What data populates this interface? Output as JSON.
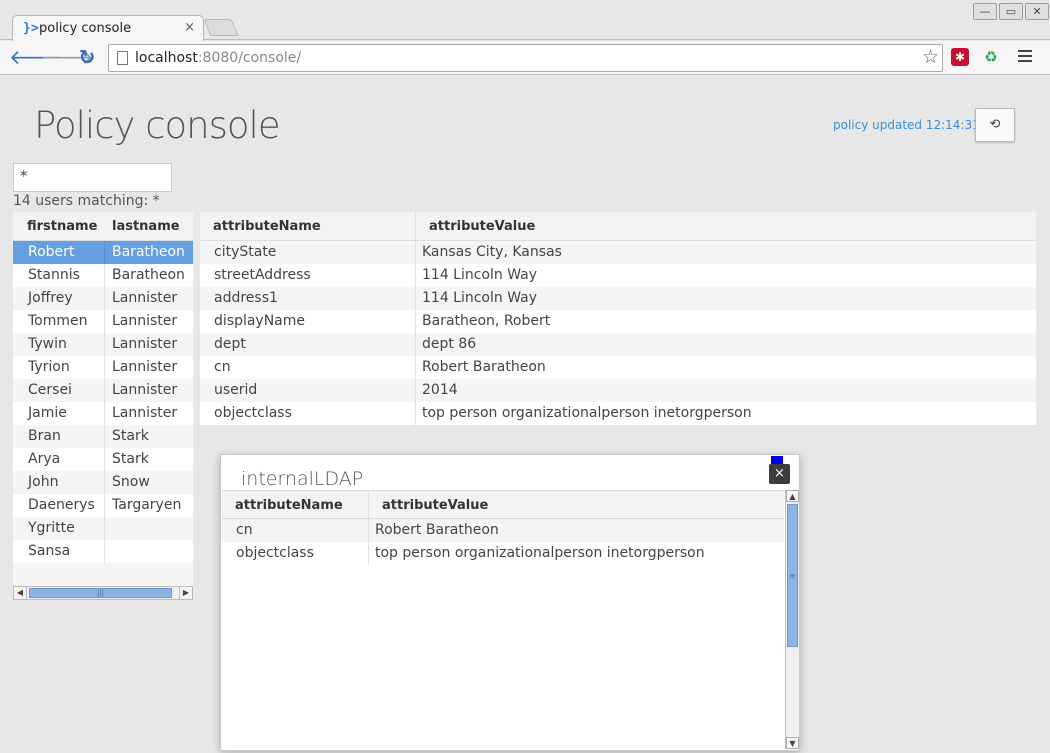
{
  "browser": {
    "tab_title": "policy console",
    "tab_icon": "}>",
    "tab_close": "×",
    "url_host": "localhost",
    "url_path": ":8080/console/",
    "window_buttons": [
      "—",
      "▭",
      "✕"
    ],
    "nav": {
      "back": "🡐",
      "forward": "🡒",
      "reload": "↻"
    },
    "star": "☆",
    "extensions": [
      {
        "name": "lastpass-icon",
        "glyph": "✱",
        "color": "#c8102e"
      },
      {
        "name": "evernote-icon",
        "glyph": "♻",
        "color": "#2ea44f"
      }
    ]
  },
  "page": {
    "title": "Policy console",
    "policy_status": "policy updated 12:14:31",
    "refresh_icon": "⟲"
  },
  "search": {
    "value": "*"
  },
  "match_count": "14 users matching: *",
  "users": {
    "headers": [
      "firstname",
      "lastname"
    ],
    "selected_index": 0,
    "rows": [
      [
        "Robert",
        "Baratheon"
      ],
      [
        "Stannis",
        "Baratheon"
      ],
      [
        "Joffrey",
        "Lannister"
      ],
      [
        "Tommen",
        "Lannister"
      ],
      [
        "Tywin",
        "Lannister"
      ],
      [
        "Tyrion",
        "Lannister"
      ],
      [
        "Cersei",
        "Lannister"
      ],
      [
        "Jamie",
        "Lannister"
      ],
      [
        "Bran",
        "Stark"
      ],
      [
        "Arya",
        "Stark"
      ],
      [
        "John",
        "Snow"
      ],
      [
        "Daenerys",
        "Targaryen"
      ],
      [
        "Ygritte",
        ""
      ],
      [
        "Sansa",
        ""
      ]
    ]
  },
  "scroll": {
    "left": "◀",
    "right": "▶",
    "grip": "|||",
    "up": "▲",
    "down": "▼",
    "vgrip": "≡"
  },
  "attributes": {
    "headers": [
      "attributeName",
      "attributeValue"
    ],
    "rows": [
      [
        "cityState",
        "Kansas City, Kansas"
      ],
      [
        "streetAddress",
        "114 Lincoln Way"
      ],
      [
        "address1",
        "114 Lincoln Way"
      ],
      [
        "displayName",
        "Baratheon, Robert"
      ],
      [
        "dept",
        "dept 86"
      ],
      [
        "cn",
        "Robert Baratheon"
      ],
      [
        "userid",
        "2014"
      ],
      [
        "objectclass",
        "top person organizationalperson inetorgperson"
      ]
    ]
  },
  "popup": {
    "title": "internalLDAP",
    "close": "×",
    "headers": [
      "attributeName",
      "attributeValue"
    ],
    "rows": [
      [
        "cn",
        "Robert Baratheon"
      ],
      [
        "objectclass",
        "top person organizationalperson inetorgperson"
      ]
    ]
  }
}
